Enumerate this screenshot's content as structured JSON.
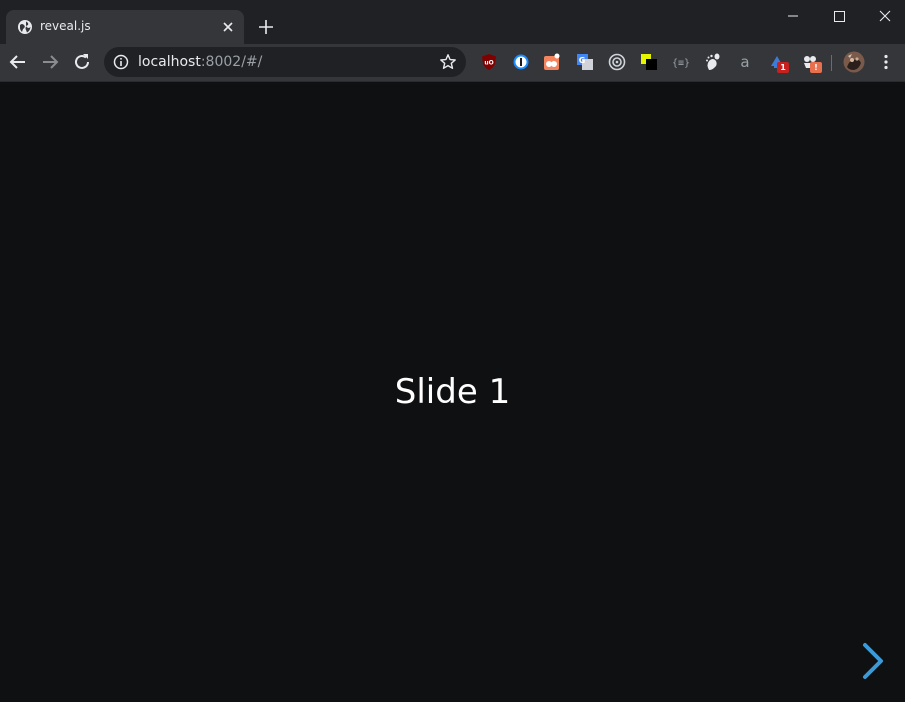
{
  "browser": {
    "tab": {
      "title": "reveal.js",
      "favicon": "globe-icon"
    },
    "address_bar": {
      "host": "localhost",
      "rest": ":8002/#/"
    },
    "extensions": [
      {
        "name": "ublock-icon",
        "badge": ""
      },
      {
        "name": "onepassword-icon",
        "badge": ""
      },
      {
        "name": "extension-icon",
        "badge": ""
      },
      {
        "name": "translate-icon",
        "badge": ""
      },
      {
        "name": "target-icon",
        "badge": ""
      },
      {
        "name": "color-picker-icon",
        "badge": ""
      },
      {
        "name": "json-icon",
        "badge": ""
      },
      {
        "name": "gnome-icon",
        "badge": ""
      },
      {
        "name": "amazon-icon",
        "badge": ""
      },
      {
        "name": "tag-icon",
        "badge": "1"
      },
      {
        "name": "extension-alert-icon",
        "badge": "!"
      }
    ],
    "colors": {
      "accent_arrow": "#3c9ad8",
      "tab_bg": "#35363a",
      "strip_bg": "#202124",
      "page_bg": "#0f1012"
    }
  },
  "slide": {
    "title": "Slide 1"
  }
}
